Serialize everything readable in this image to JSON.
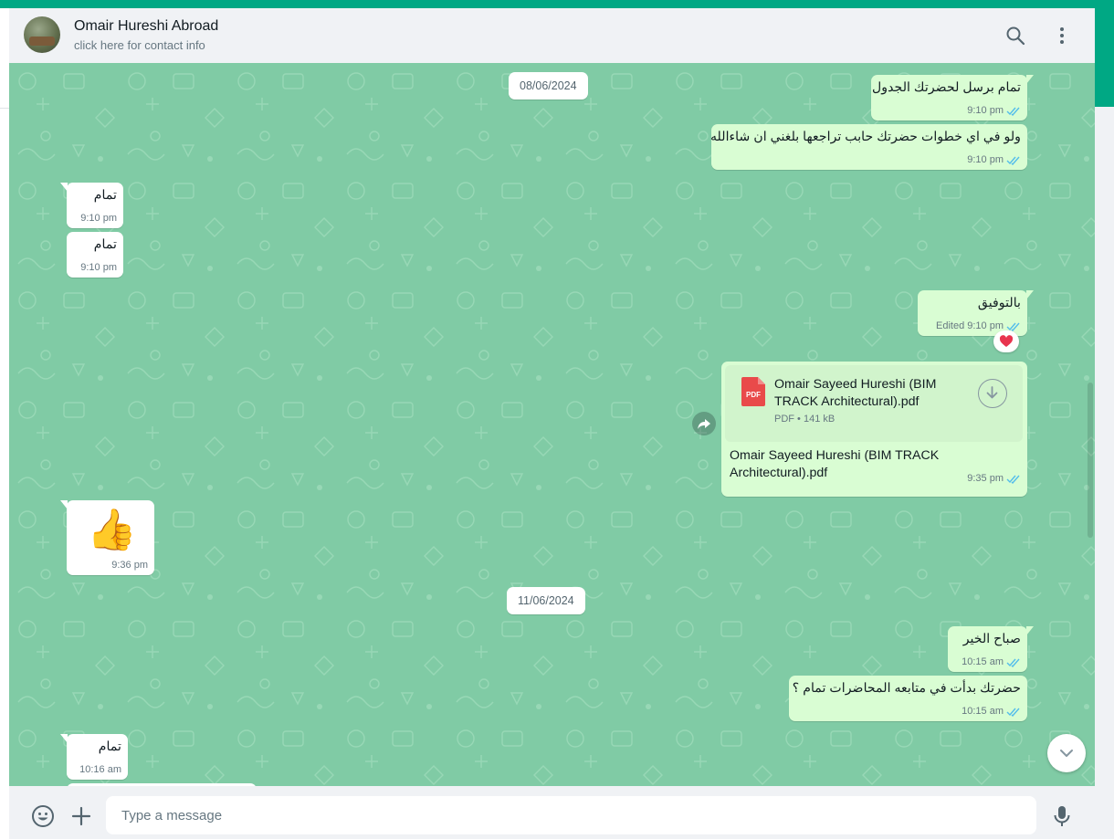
{
  "header": {
    "contact_name": "Omair Hureshi Abroad",
    "contact_subtitle": "click here for contact info"
  },
  "dates": [
    "08/06/2024",
    "11/06/2024"
  ],
  "messages": [
    {
      "dir": "out",
      "text": "تمام برسل لحضرتك الجدول",
      "time": "9:10 pm"
    },
    {
      "dir": "out",
      "text": "ولو في اي خطوات حضرتك حابب تراجعها بلغني ان شاءالله",
      "time": "9:10 pm"
    },
    {
      "dir": "in",
      "text": "تمام",
      "time": "9:10 pm"
    },
    {
      "dir": "in",
      "text": "تمام",
      "time": "9:10 pm"
    },
    {
      "dir": "out",
      "text": "بالتوفيق",
      "time": "Edited 9:10 pm",
      "reaction": "❤️"
    },
    {
      "dir": "out",
      "type": "document",
      "file_name": "Omair Sayeed Hureshi (BIM TRACK Architectural).pdf",
      "file_type": "PDF",
      "file_size": "141 kB",
      "file_badge": "PDF",
      "caption": "Omair Sayeed Hureshi (BIM TRACK Architectural).pdf",
      "time": "9:35 pm"
    },
    {
      "dir": "in",
      "type": "emoji",
      "text": "👍",
      "time": "9:36 pm"
    },
    {
      "dir": "out",
      "text": "صباح الخير",
      "time": "10:15 am"
    },
    {
      "dir": "out",
      "text": "حضرتك بدأت في متابعه المحاضرات تمام ؟",
      "time": "10:15 am"
    },
    {
      "dir": "in",
      "text": "تمام",
      "time": "10:16 am"
    }
  ],
  "composer": {
    "placeholder": "Type a message"
  },
  "colors": {
    "accent": "#00a884",
    "chat_background": "#80cba5",
    "outgoing_bubble": "#d9fdd3",
    "incoming_bubble": "#ffffff",
    "read_ticks": "#53bdeb",
    "reaction_heart": "#e8344e",
    "pdf_red": "#e94a4a"
  },
  "icons": [
    "search-icon",
    "menu-icon",
    "emoji-icon",
    "plus-icon",
    "mic-icon",
    "forward-icon",
    "download-icon",
    "chevron-down-icon",
    "pdf-icon",
    "double-check-icon"
  ]
}
